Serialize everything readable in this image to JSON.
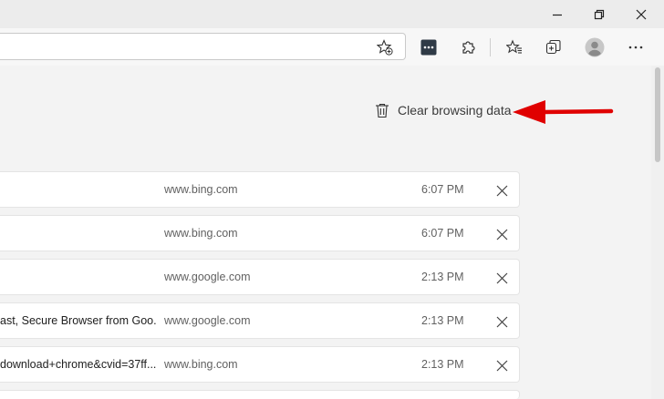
{
  "window": {
    "minimize_icon": "minimize-icon",
    "restore_icon": "restore-icon",
    "close_icon": "close-icon"
  },
  "toolbar": {
    "icons": [
      "favorite-add-icon",
      "extension-badge-icon",
      "extensions-puzzle-icon",
      "favorites-icon",
      "collections-icon",
      "profile-avatar-icon",
      "more-options-icon"
    ]
  },
  "history": {
    "clear_label": "Clear browsing data",
    "annotation_color": "#e00000",
    "rows": [
      {
        "title": "",
        "domain": "www.bing.com",
        "time": "6:07 PM"
      },
      {
        "title": "",
        "domain": "www.bing.com",
        "time": "6:07 PM"
      },
      {
        "title": "",
        "domain": "www.google.com",
        "time": "2:13 PM"
      },
      {
        "title": "ast, Secure Browser from Goo...",
        "domain": "www.google.com",
        "time": "2:13 PM"
      },
      {
        "title": "download+chrome&cvid=37ff...",
        "domain": "www.bing.com",
        "time": "2:13 PM"
      }
    ]
  }
}
